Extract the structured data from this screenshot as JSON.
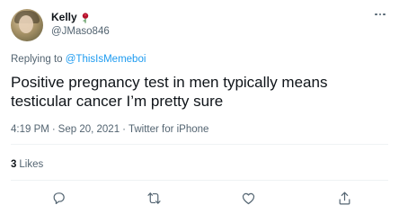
{
  "author": {
    "display_name": "Kelly",
    "handle": "@JMaso846",
    "emoji": "rose-icon"
  },
  "reply": {
    "prefix": "Replying to",
    "mention": "@ThisIsMemeboi"
  },
  "tweet": {
    "text": "Positive pregnancy test in men typically means testicular cancer I’m pretty sure",
    "time": "4:19 PM",
    "sep1": "·",
    "date": "Sep 20, 2021",
    "sep2": "·",
    "source": "Twitter for iPhone"
  },
  "stats": {
    "likes_count": "3",
    "likes_label": "Likes"
  },
  "actions": [
    "reply-icon",
    "retweet-icon",
    "like-icon",
    "share-icon"
  ],
  "colors": {
    "link": "#1d9bf0",
    "secondary_text": "#536471",
    "primary_text": "#0f1419",
    "divider": "#eff3f4",
    "rose": "#b5122c"
  }
}
